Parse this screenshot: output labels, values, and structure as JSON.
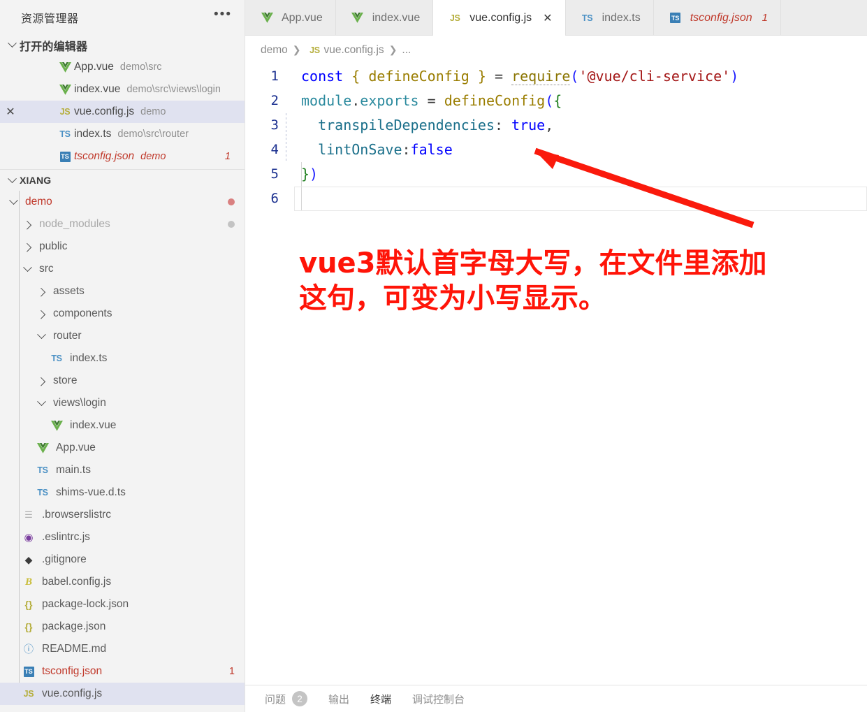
{
  "sidebar": {
    "title": "资源管理器",
    "more_icon": "ellipsis-icon",
    "open_editors": {
      "label": "打开的编辑器",
      "items": [
        {
          "icon": "vue-icon",
          "name": "App.vue",
          "path": "demo\\src",
          "active": false,
          "modified": false,
          "closable": false,
          "badge": ""
        },
        {
          "icon": "vue-icon",
          "name": "index.vue",
          "path": "demo\\src\\views\\login",
          "active": false,
          "modified": false,
          "closable": false,
          "badge": ""
        },
        {
          "icon": "js-icon",
          "name": "vue.config.js",
          "path": "demo",
          "active": true,
          "modified": false,
          "closable": true,
          "badge": ""
        },
        {
          "icon": "ts-icon",
          "name": "index.ts",
          "path": "demo\\src\\router",
          "active": false,
          "modified": false,
          "closable": false,
          "badge": ""
        },
        {
          "icon": "tsjson-icon",
          "name": "tsconfig.json",
          "path": "demo",
          "active": false,
          "modified": true,
          "closable": false,
          "badge": "1"
        }
      ]
    },
    "workspace": {
      "label": "XIANG",
      "items": [
        {
          "label": "demo",
          "depth": 0,
          "type": "folder",
          "state": "open",
          "icon": "chevron-down-icon",
          "color": "red",
          "dot": "red",
          "badge": ""
        },
        {
          "label": "node_modules",
          "depth": 1,
          "type": "folder",
          "state": "closed",
          "icon": "chevron-right-icon",
          "color": "dim",
          "dot": "gray",
          "badge": ""
        },
        {
          "label": "public",
          "depth": 1,
          "type": "folder",
          "state": "closed",
          "icon": "chevron-right-icon",
          "color": "norm",
          "dot": "",
          "badge": ""
        },
        {
          "label": "src",
          "depth": 1,
          "type": "folder",
          "state": "open",
          "icon": "chevron-down-icon",
          "color": "norm",
          "dot": "",
          "badge": ""
        },
        {
          "label": "assets",
          "depth": 2,
          "type": "folder",
          "state": "closed",
          "icon": "chevron-right-icon",
          "color": "norm",
          "dot": "",
          "badge": ""
        },
        {
          "label": "components",
          "depth": 2,
          "type": "folder",
          "state": "closed",
          "icon": "chevron-right-icon",
          "color": "norm",
          "dot": "",
          "badge": ""
        },
        {
          "label": "router",
          "depth": 2,
          "type": "folder",
          "state": "open",
          "icon": "chevron-down-icon",
          "color": "norm",
          "dot": "",
          "badge": ""
        },
        {
          "label": "index.ts",
          "depth": 3,
          "type": "file",
          "state": "",
          "icon": "ts-icon",
          "color": "norm",
          "dot": "",
          "badge": ""
        },
        {
          "label": "store",
          "depth": 2,
          "type": "folder",
          "state": "closed",
          "icon": "chevron-right-icon",
          "color": "norm",
          "dot": "",
          "badge": ""
        },
        {
          "label": "views\\login",
          "depth": 2,
          "type": "folder",
          "state": "open",
          "icon": "chevron-down-icon",
          "color": "norm",
          "dot": "",
          "badge": ""
        },
        {
          "label": "index.vue",
          "depth": 3,
          "type": "file",
          "state": "",
          "icon": "vue-icon",
          "color": "norm",
          "dot": "",
          "badge": ""
        },
        {
          "label": "App.vue",
          "depth": 2,
          "type": "file",
          "state": "",
          "icon": "vue-icon",
          "color": "norm",
          "dot": "",
          "badge": ""
        },
        {
          "label": "main.ts",
          "depth": 2,
          "type": "file",
          "state": "",
          "icon": "ts-icon",
          "color": "norm",
          "dot": "",
          "badge": ""
        },
        {
          "label": "shims-vue.d.ts",
          "depth": 2,
          "type": "file",
          "state": "",
          "icon": "ts-icon",
          "color": "norm",
          "dot": "",
          "badge": ""
        },
        {
          "label": ".browserslistrc",
          "depth": 1,
          "type": "file",
          "state": "",
          "icon": "list-icon",
          "color": "norm",
          "dot": "",
          "badge": ""
        },
        {
          "label": ".eslintrc.js",
          "depth": 1,
          "type": "file",
          "state": "",
          "icon": "eslint-icon",
          "color": "norm",
          "dot": "",
          "badge": ""
        },
        {
          "label": ".gitignore",
          "depth": 1,
          "type": "file",
          "state": "",
          "icon": "git-icon",
          "color": "norm",
          "dot": "",
          "badge": ""
        },
        {
          "label": "babel.config.js",
          "depth": 1,
          "type": "file",
          "state": "",
          "icon": "babel-icon",
          "color": "norm",
          "dot": "",
          "badge": ""
        },
        {
          "label": "package-lock.json",
          "depth": 1,
          "type": "file",
          "state": "",
          "icon": "json-icon",
          "color": "norm",
          "dot": "",
          "badge": ""
        },
        {
          "label": "package.json",
          "depth": 1,
          "type": "file",
          "state": "",
          "icon": "json-icon",
          "color": "norm",
          "dot": "",
          "badge": ""
        },
        {
          "label": "README.md",
          "depth": 1,
          "type": "file",
          "state": "",
          "icon": "info-icon",
          "color": "norm",
          "dot": "",
          "badge": ""
        },
        {
          "label": "tsconfig.json",
          "depth": 1,
          "type": "file",
          "state": "",
          "icon": "tsjson-icon",
          "color": "red",
          "dot": "",
          "badge": "1"
        },
        {
          "label": "vue.config.js",
          "depth": 1,
          "type": "file",
          "state": "",
          "icon": "js-icon",
          "color": "norm",
          "dot": "",
          "badge": "",
          "selected": true
        }
      ]
    }
  },
  "tabs": [
    {
      "icon": "vue-icon",
      "label": "App.vue",
      "active": false,
      "modified": false,
      "close": "",
      "badge": ""
    },
    {
      "icon": "vue-icon",
      "label": "index.vue",
      "active": false,
      "modified": false,
      "close": "",
      "badge": ""
    },
    {
      "icon": "js-icon",
      "label": "vue.config.js",
      "active": true,
      "modified": false,
      "close": "✕",
      "badge": ""
    },
    {
      "icon": "ts-icon",
      "label": "index.ts",
      "active": false,
      "modified": false,
      "close": "",
      "badge": ""
    },
    {
      "icon": "tsjson-icon",
      "label": "tsconfig.json",
      "active": false,
      "modified": true,
      "close": "",
      "badge": "1"
    }
  ],
  "breadcrumb": {
    "items": [
      {
        "label": "demo",
        "icon": ""
      },
      {
        "label": "vue.config.js",
        "icon": "js-icon"
      },
      {
        "label": "...",
        "icon": ""
      }
    ],
    "separator": "❯"
  },
  "editor": {
    "lines": [
      {
        "num": "1",
        "indent": false,
        "tokens": [
          {
            "t": "const",
            "c": "t-kw"
          },
          {
            "t": " ",
            "c": "t-op"
          },
          {
            "t": "{",
            "c": "t-brace"
          },
          {
            "t": " ",
            "c": "t-op"
          },
          {
            "t": "defineConfig",
            "c": "t-var"
          },
          {
            "t": " ",
            "c": "t-op"
          },
          {
            "t": "}",
            "c": "t-brace"
          },
          {
            "t": " ",
            "c": "t-op"
          },
          {
            "t": "=",
            "c": "t-op"
          },
          {
            "t": " ",
            "c": "t-op"
          },
          {
            "t": "require",
            "c": "t-fn"
          },
          {
            "t": "(",
            "c": "t-paren"
          },
          {
            "t": "'@vue/cli-service'",
            "c": "t-str"
          },
          {
            "t": ")",
            "c": "t-paren"
          }
        ]
      },
      {
        "num": "2",
        "indent": false,
        "tokens": [
          {
            "t": "module",
            "c": "t-obj"
          },
          {
            "t": ".",
            "c": "t-op"
          },
          {
            "t": "exports",
            "c": "t-obj"
          },
          {
            "t": " ",
            "c": "t-op"
          },
          {
            "t": "=",
            "c": "t-op"
          },
          {
            "t": " ",
            "c": "t-op"
          },
          {
            "t": "defineConfig",
            "c": "t-var"
          },
          {
            "t": "(",
            "c": "t-paren"
          },
          {
            "t": "{",
            "c": "t-paren2"
          }
        ]
      },
      {
        "num": "3",
        "indent": true,
        "tokens": [
          {
            "t": "  transpileDependencies",
            "c": "t-prop"
          },
          {
            "t": ": ",
            "c": "t-op"
          },
          {
            "t": "true",
            "c": "t-bool"
          },
          {
            "t": ",",
            "c": "t-op"
          }
        ]
      },
      {
        "num": "4",
        "indent": true,
        "tokens": [
          {
            "t": "  lintOnSave",
            "c": "t-prop"
          },
          {
            "t": ":",
            "c": "t-op"
          },
          {
            "t": "false",
            "c": "t-bool"
          }
        ]
      },
      {
        "num": "5",
        "indent": false,
        "tokens": [
          {
            "t": "}",
            "c": "t-paren2"
          },
          {
            "t": ")",
            "c": "t-paren"
          }
        ]
      },
      {
        "num": "6",
        "indent": false,
        "current": true,
        "tokens": []
      }
    ]
  },
  "annotation": {
    "line1": "vue3默认首字母大写，在文件里添加",
    "line2": "这句，可变为小写显示。",
    "color": "#ff1408",
    "arrow_color": "#fa1a0c"
  },
  "panel": {
    "items": [
      {
        "label": "问题",
        "count": "2",
        "active": false
      },
      {
        "label": "输出",
        "count": "",
        "active": false
      },
      {
        "label": "终端",
        "count": "",
        "active": true
      },
      {
        "label": "调试控制台",
        "count": "",
        "active": false
      }
    ]
  }
}
